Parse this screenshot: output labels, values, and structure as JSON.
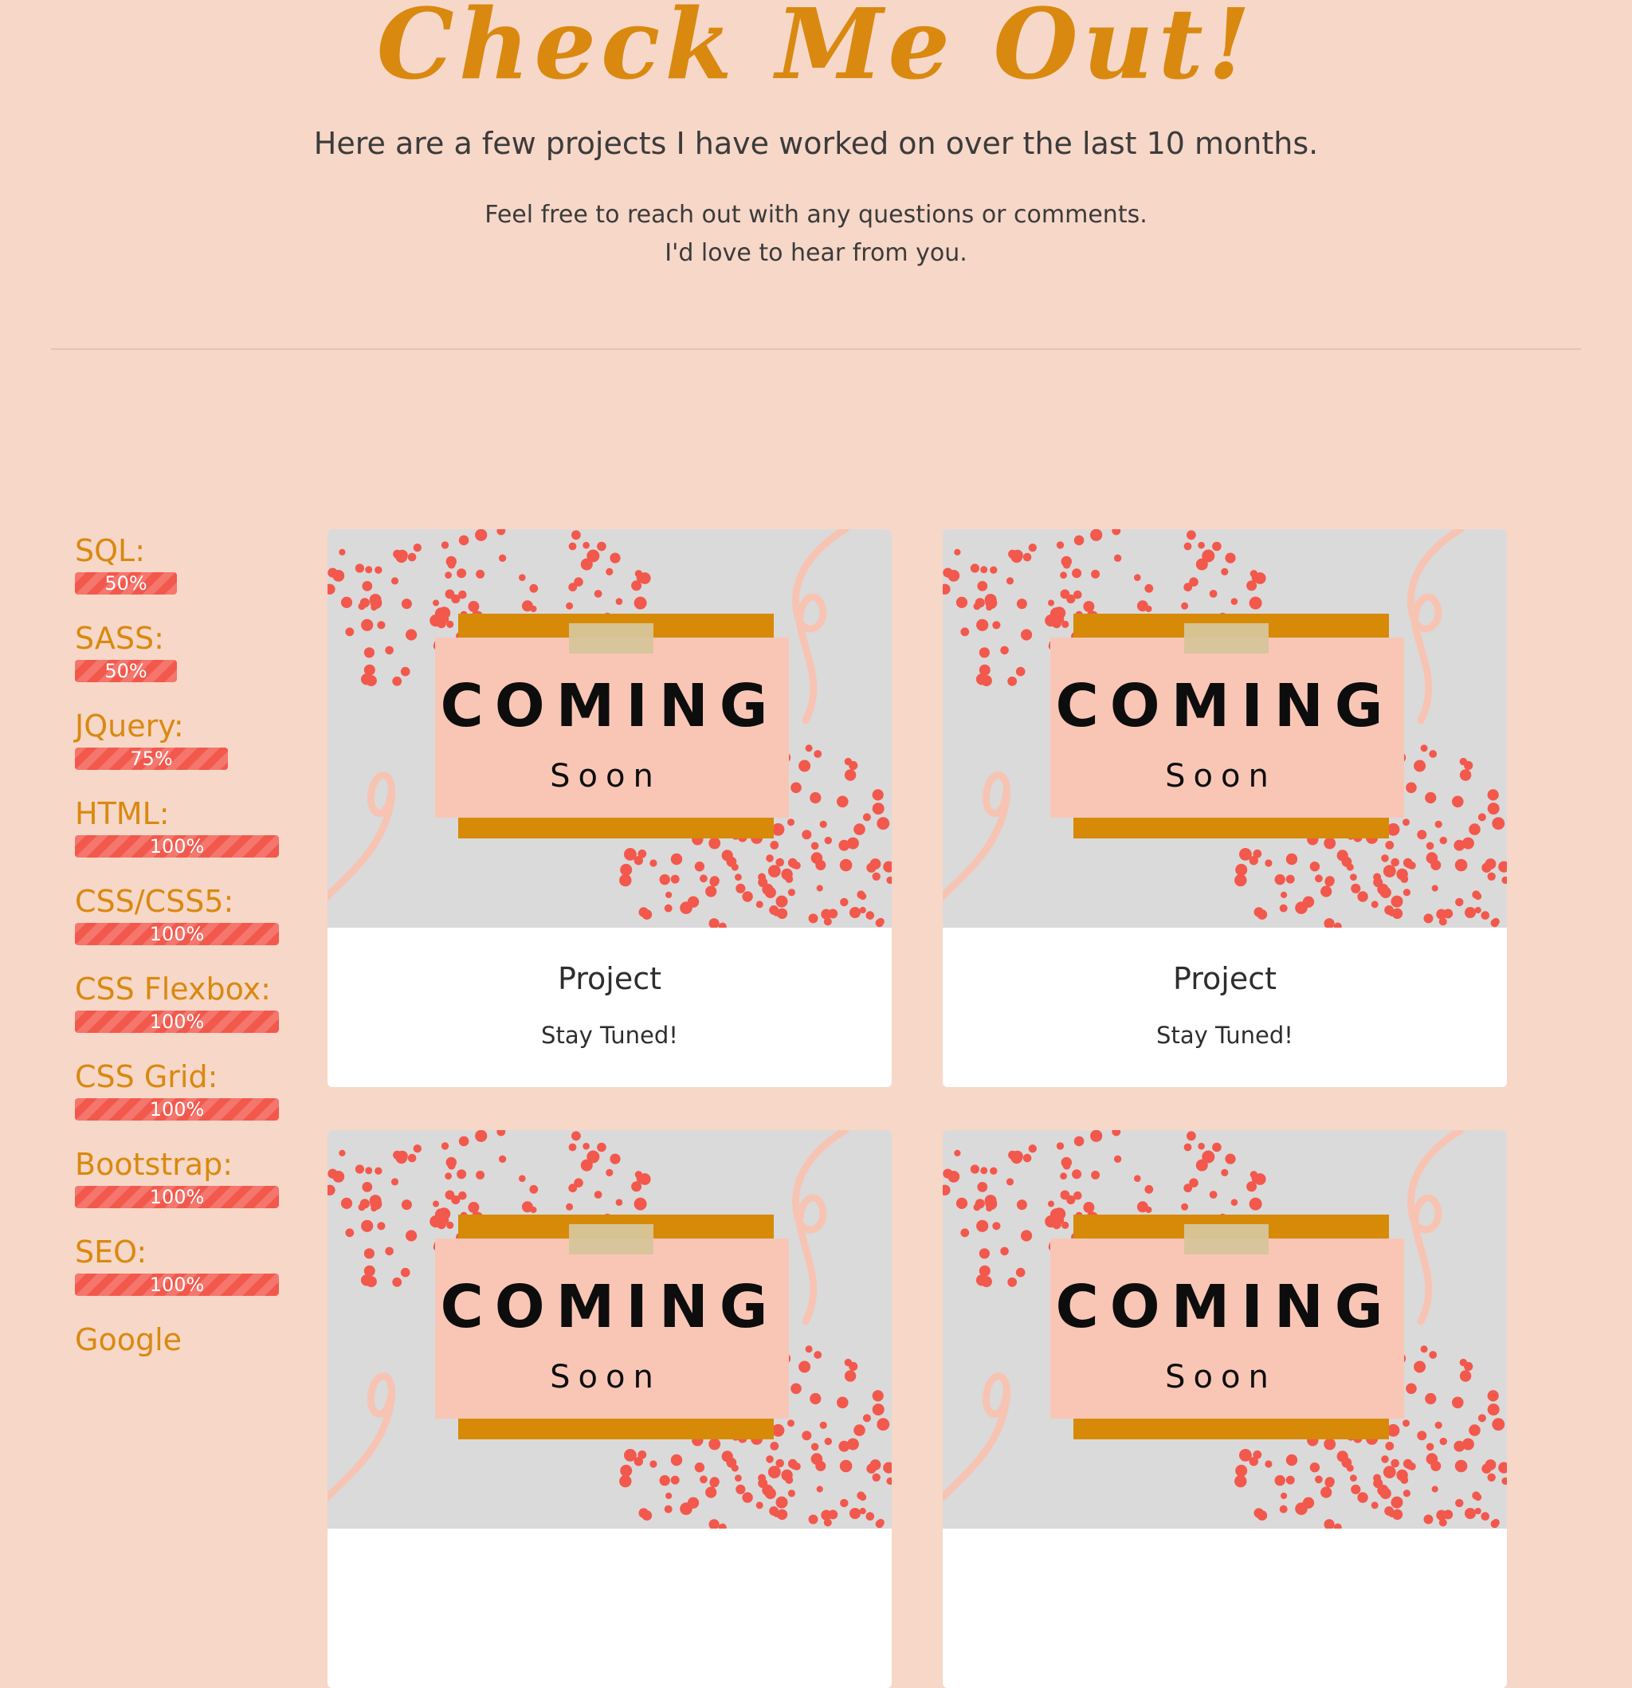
{
  "header": {
    "title": "Check Me Out!",
    "subtitle": "Here are a few projects I have worked on over the last 10 months.",
    "note_line1": "Feel free to reach out with any questions or comments.",
    "note_line2": "I'd love to hear from you."
  },
  "skills": [
    {
      "name": "SQL:",
      "percent": 50,
      "label": "50%"
    },
    {
      "name": "SASS:",
      "percent": 50,
      "label": "50%"
    },
    {
      "name": "JQuery:",
      "percent": 75,
      "label": "75%"
    },
    {
      "name": "HTML:",
      "percent": 100,
      "label": "100%"
    },
    {
      "name": "CSS/CSS5:",
      "percent": 100,
      "label": "100%"
    },
    {
      "name": "CSS Flexbox:",
      "percent": 100,
      "label": "100%"
    },
    {
      "name": "CSS Grid:",
      "percent": 100,
      "label": "100%"
    },
    {
      "name": "Bootstrap:",
      "percent": 100,
      "label": "100%"
    },
    {
      "name": "SEO:",
      "percent": 100,
      "label": "100%"
    },
    {
      "name": "Google"
    }
  ],
  "projects": [
    {
      "image_heading": "COMING",
      "image_subheading": "Soon",
      "title": "Project",
      "text": "Stay Tuned!"
    },
    {
      "image_heading": "COMING",
      "image_subheading": "Soon",
      "title": "Project",
      "text": "Stay Tuned!"
    },
    {
      "image_heading": "COMING",
      "image_subheading": "Soon"
    },
    {
      "image_heading": "COMING",
      "image_subheading": "Soon"
    }
  ],
  "colors": {
    "background": "#f7d7c8",
    "accent": "#d9890f",
    "bar": "#f2584c",
    "card_image_bg": "#dadada",
    "card_panel": "#f9c6b6",
    "card_band": "#d68a07"
  }
}
